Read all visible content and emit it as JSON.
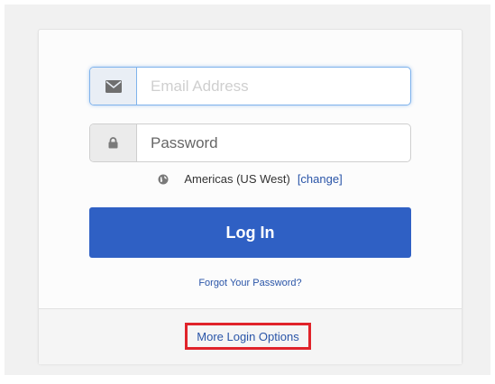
{
  "login": {
    "email_placeholder": "Email Address",
    "password_placeholder": "Password",
    "region_label": "Americas (US West)",
    "region_change": "[change]",
    "login_button": "Log In",
    "forgot_password": "Forgot Your Password?",
    "more_options": "More Login Options"
  },
  "icons": {
    "email": "envelope-icon",
    "password": "lock-icon",
    "region": "globe-icon"
  },
  "colors": {
    "primary_button": "#2f60c4",
    "link": "#2a55a8",
    "highlight_border": "#e0232a",
    "focus_border": "#7fb3ec"
  }
}
